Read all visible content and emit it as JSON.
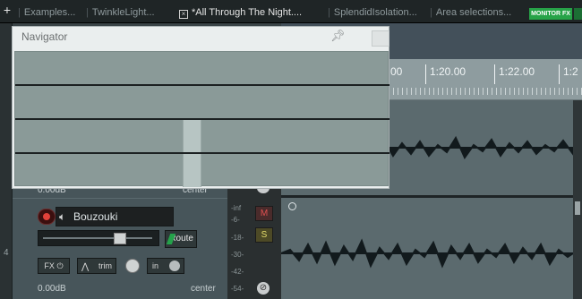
{
  "tabs": {
    "add_label": "+",
    "items": [
      {
        "label": "Examples...",
        "active": false
      },
      {
        "label": "TwinkleLight...",
        "active": false
      },
      {
        "label": "*All Through The Night....",
        "active": true,
        "close_icon": "close-box-icon"
      },
      {
        "label": "SplendidIsolation...",
        "active": false
      },
      {
        "label": "Area selections...",
        "active": false
      }
    ],
    "monitor_fx_label": "MONITOR FX"
  },
  "navigator": {
    "title": "Navigator",
    "pin_icon": "pin-icon"
  },
  "ruler": {
    "labels": [
      "00",
      "1:20.00",
      "1:22.00",
      "1:2"
    ]
  },
  "previous_track": {
    "volume": "0.00dB",
    "pan": "center"
  },
  "track": {
    "number": "4",
    "name": "Bouzouki",
    "route_label": "Route",
    "fx_label": "FX",
    "trim_label": "trim",
    "input_label": "in",
    "volume": "0.00dB",
    "pan": "center",
    "mute_label": "M",
    "solo_label": "S",
    "meter_scale": [
      "-inf",
      "-6-",
      "-18-",
      "-30-",
      "-42-",
      "-54-"
    ]
  },
  "colors": {
    "monitor_fx": "#27a348",
    "record_arm": "#e0413a",
    "mute": "#e15151",
    "solo": "#e7df6d"
  }
}
